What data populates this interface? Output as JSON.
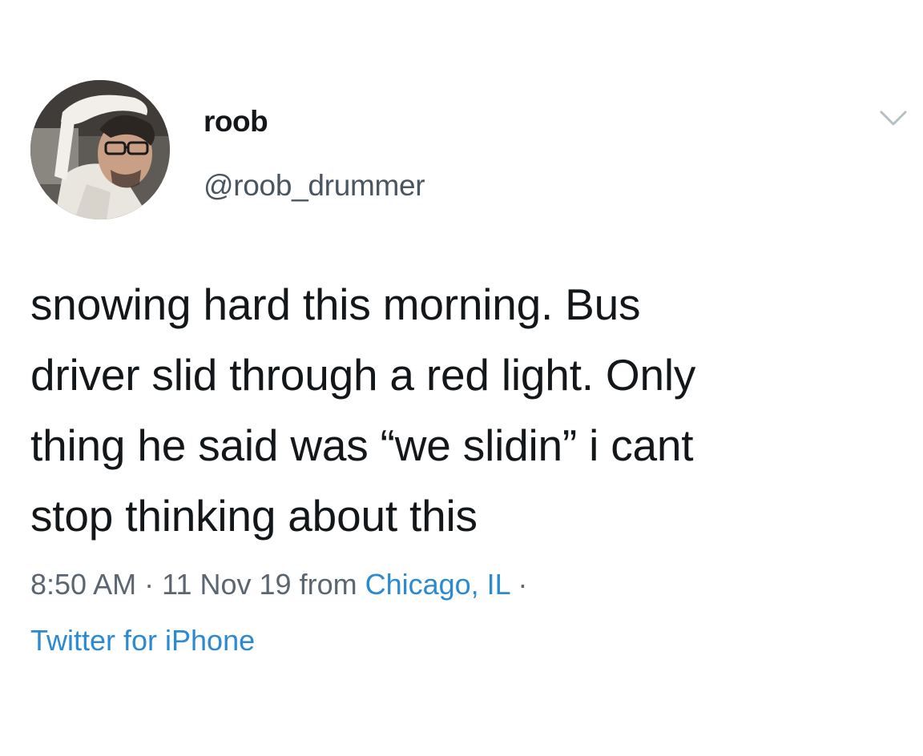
{
  "tweet": {
    "display_name": "roob",
    "handle": "@roob_drummer",
    "text": "snowing hard this morning. Bus\ndriver slid through a red light. Only\nthing he said was “we slidin” i cant\nstop thinking about this",
    "time": "8:50 AM",
    "separator": "·",
    "date": "11 Nov 19",
    "from_label": "from",
    "location": "Chicago, IL",
    "source": "Twitter for iPhone"
  },
  "icons": {
    "menu": "chevron-down-icon",
    "avatar": "avatar"
  },
  "colors": {
    "text": "#14171a",
    "secondary": "#5b6670",
    "link": "#2b8ad1",
    "background": "#ffffff"
  }
}
